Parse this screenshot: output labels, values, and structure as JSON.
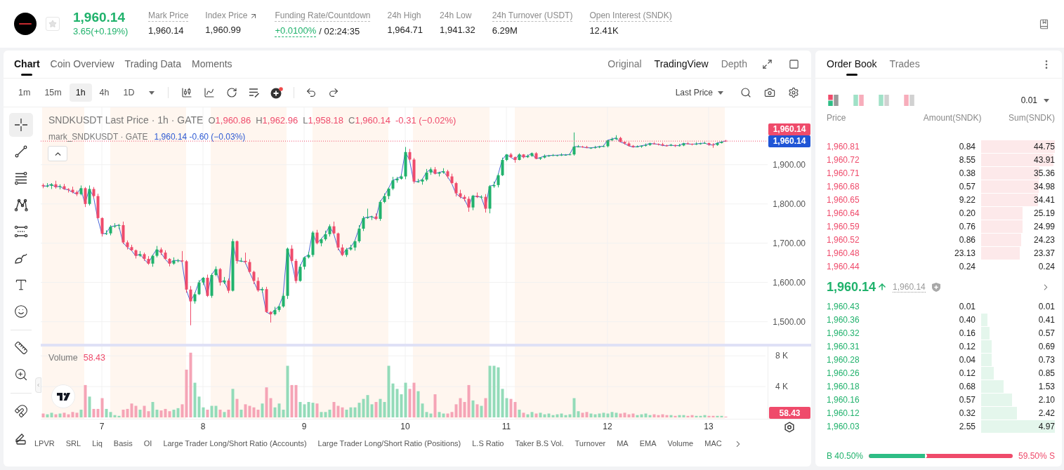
{
  "header": {
    "price": "1,960.14",
    "change": "3.65(+0.19%)",
    "rising": true,
    "favorite": false,
    "stats": [
      {
        "label": "Mark Price",
        "value": "1,960.14",
        "kind": "tooltip"
      },
      {
        "label": "Index Price",
        "value": "1,960.99",
        "kind": "link"
      },
      {
        "label": "Funding Rate/Countdown",
        "value": "+0.0100%",
        "countdown": "/ 02:24:35",
        "kind": "rate"
      },
      {
        "label": "24h High",
        "value": "1,964.71",
        "kind": "plain"
      },
      {
        "label": "24h Low",
        "value": "1,941.32",
        "kind": "plain"
      },
      {
        "label": "24h Turnover (USDT)",
        "value": "6.29M",
        "kind": "tooltip"
      },
      {
        "label": "Open Interest (SNDK)",
        "value": "12.41K",
        "kind": "tooltip"
      }
    ]
  },
  "chart_panel": {
    "tabs": [
      {
        "label": "Chart",
        "selected": true
      },
      {
        "label": "Coin Overview",
        "selected": false
      },
      {
        "label": "Trading Data",
        "selected": false
      },
      {
        "label": "Moments",
        "selected": false
      }
    ],
    "views": [
      {
        "label": "Original",
        "selected": false
      },
      {
        "label": "TradingView",
        "selected": true
      },
      {
        "label": "Depth",
        "selected": false
      }
    ],
    "intervals": [
      {
        "label": "1m",
        "selected": false
      },
      {
        "label": "15m",
        "selected": false
      },
      {
        "label": "1h",
        "selected": true
      },
      {
        "label": "4h",
        "selected": false
      },
      {
        "label": "1D",
        "selected": false
      }
    ],
    "price_source": "Last Price",
    "tool_groups": [
      {
        "tools": [
          {
            "kind": "crosshair",
            "selected": true
          },
          {
            "kind": "trend_line",
            "selected": false
          },
          {
            "kind": "fib",
            "selected": false
          },
          {
            "kind": "pattern",
            "selected": false
          },
          {
            "kind": "channel",
            "selected": false
          },
          {
            "kind": "brush",
            "selected": false
          },
          {
            "kind": "text",
            "selected": false
          },
          {
            "kind": "emoji",
            "selected": false
          }
        ]
      },
      {
        "tools": [
          {
            "kind": "measure",
            "selected": false
          },
          {
            "kind": "zoom",
            "selected": false
          }
        ]
      },
      {
        "tools": [
          {
            "kind": "magnet",
            "selected": false
          },
          {
            "kind": "lock",
            "selected": false
          }
        ]
      }
    ],
    "legend": {
      "title": "SNDKUSDT Last Price · 1h · GATE",
      "rising": false,
      "ohlc": [
        {
          "key": "O",
          "value": "1,960.86"
        },
        {
          "key": "H",
          "value": "1,962.96"
        },
        {
          "key": "L",
          "value": "1,958.18"
        },
        {
          "key": "C",
          "value": "1,960.14"
        }
      ],
      "change": "-0.31 (−0.02%)"
    },
    "mark_legend": {
      "title": "mark_SNDKUSDT · GATE",
      "value": "1,960.14 -0.60 (−0.03%)"
    },
    "price_chart": {
      "axis_labels": [
        "1,900.00",
        "1,800.00",
        "1,700.00",
        "1,600.00",
        "1,500.00"
      ],
      "last_label": "1,960.14",
      "mark_label": "1,960.14"
    },
    "volume_chart": {
      "value": "58.43",
      "axis_label": "58.43",
      "chart_data": {
        "type": "bar",
        "categories": [
          null,
          null,
          null,
          null,
          null,
          null,
          null,
          null,
          null,
          null,
          null,
          null,
          null,
          null,
          "7",
          null,
          null,
          null,
          null,
          null,
          null,
          null,
          null,
          null,
          null,
          null,
          null,
          null,
          null,
          null,
          null,
          null,
          null,
          null,
          null,
          null,
          null,
          null,
          "8",
          null,
          null,
          null,
          null,
          null,
          null,
          null,
          null,
          null,
          null,
          null,
          null,
          null,
          null,
          null,
          null,
          null,
          null,
          null,
          null,
          null,
          null,
          null,
          "9",
          null,
          null,
          null,
          null,
          null,
          null,
          null,
          null,
          null,
          null,
          null,
          null,
          null,
          null,
          null,
          null,
          null,
          null,
          null,
          null,
          null,
          null,
          null,
          "10",
          null,
          null,
          null,
          null,
          null,
          null,
          null,
          null,
          null,
          null,
          null,
          null,
          null,
          null,
          null,
          null,
          null,
          null,
          null,
          null,
          null,
          null,
          null,
          "11",
          null,
          null,
          null,
          null,
          null,
          null,
          null,
          null,
          null,
          null,
          null,
          null,
          null,
          null,
          null,
          null,
          null,
          null,
          null,
          null,
          null,
          null,
          null,
          "12",
          null,
          null,
          null,
          null,
          null,
          null,
          null,
          null,
          null,
          null,
          null,
          null,
          null,
          null,
          null,
          null,
          null,
          null,
          null,
          null,
          null,
          null,
          null,
          "13",
          null,
          null,
          null,
          null,
          null,
          null,
          null,
          null,
          null,
          null,
          null,
          null,
          null
        ],
        "ylim": [
          0,
          9.2
        ],
        "yticks": [
          {
            "value": 4,
            "label": "4 K"
          },
          {
            "value": 8,
            "label": "8 K"
          }
        ],
        "series": [
          {
            "name": "Volume",
            "values": [
              0.5,
              0.4,
              0.6,
              0.4,
              0.5,
              0.6,
              0.4,
              0.7,
              0.6,
              1.0,
              4.2,
              2.7,
              1.1,
              1.1,
              2.5,
              1.1,
              0.7,
              0.3,
              0.2,
              1.0,
              1.1,
              1.8,
              1.5,
              1.0,
              1.5,
              0.8,
              2.0,
              1.0,
              0.9,
              1.1,
              0.8,
              1.0,
              1.2,
              1.7,
              6.2,
              8.4,
              4.5,
              2.7,
              1.3,
              1.0,
              1.5,
              1.5,
              1.0,
              0.7,
              1.0,
              3.7,
              2.4,
              1.0,
              1.7,
              1.5,
              1.3,
              1.0,
              1.8,
              3.9,
              2.5,
              1.3,
              1.8,
              1.0,
              6.7,
              4.2,
              4.2,
              2.0,
              1.7,
              2.0,
              1.9,
              1.8,
              0.7,
              0.7,
              1.0,
              2.0,
              1.5,
              1.3,
              1.0,
              1.3,
              1.3,
              1.9,
              2.4,
              2.9,
              1.7,
              2.0,
              2.4,
              2.0,
              6.7,
              4.4,
              3.7,
              3.0,
              4.5,
              3.7,
              4.5,
              3.4,
              1.8,
              0.7,
              0.5,
              3.0,
              0.7,
              0.5,
              0.5,
              0.7,
              1.7,
              2.5,
              2.0,
              4.2,
              2.2,
              1.7,
              1.5,
              2.5,
              6.7,
              6.7,
              6.5,
              3.7,
              2.5,
              2.4,
              2.0,
              1.0,
              0.6,
              0.4,
              0.7,
              0.5,
              0.6,
              0.4,
              0.5,
              0.3,
              0.4,
              0.5,
              0.3,
              0.4,
              2.5,
              0.8,
              0.6,
              0.7,
              0.5,
              0.4,
              0.5,
              0.6,
              0.5,
              0.7,
              0.6,
              0.5,
              0.6,
              0.4,
              0.5,
              0.3,
              0.4,
              0.5,
              0.3,
              0.4,
              0.3,
              0.4,
              0.3,
              0.3,
              0.2,
              0.3,
              0.3,
              0.2,
              0.3,
              0.2,
              0.2,
              0.3,
              0.2,
              0.2,
              0.2,
              0.2,
              0.1,
              null,
              null,
              null,
              null,
              null,
              null,
              null,
              null,
              null
            ]
          }
        ]
      }
    },
    "indicators": [
      "LPVR",
      "SRL",
      "Liq",
      "Basis",
      "OI",
      "Large Trader Long/Short Ratio (Accounts)",
      "Large Trader Long/Short Ratio (Positions)",
      "L.S Ratio",
      "Taker B.S Vol.",
      "Turnover",
      "MA",
      "EMA",
      "Volume",
      "MAC"
    ]
  },
  "order_book": {
    "tabs": [
      {
        "label": "Order Book",
        "selected": true
      },
      {
        "label": "Trades",
        "selected": false
      }
    ],
    "layouts": [
      {
        "kind": "combined",
        "selected": true
      },
      {
        "kind": "side_by_side",
        "selected": false
      },
      {
        "kind": "bids",
        "selected": false
      },
      {
        "kind": "asks",
        "selected": false
      }
    ],
    "precision": "0.01",
    "columns": [
      "Price",
      "Amount(SNDK)",
      "Sum(SNDK)"
    ],
    "asks": [
      {
        "price": "1,960.81",
        "amount": "0.84",
        "sum": "44.75"
      },
      {
        "price": "1,960.72",
        "amount": "8.55",
        "sum": "43.91"
      },
      {
        "price": "1,960.71",
        "amount": "0.38",
        "sum": "35.36"
      },
      {
        "price": "1,960.68",
        "amount": "0.57",
        "sum": "34.98"
      },
      {
        "price": "1,960.65",
        "amount": "9.22",
        "sum": "34.41"
      },
      {
        "price": "1,960.64",
        "amount": "0.20",
        "sum": "25.19"
      },
      {
        "price": "1,960.59",
        "amount": "0.76",
        "sum": "24.99"
      },
      {
        "price": "1,960.52",
        "amount": "0.86",
        "sum": "24.23"
      },
      {
        "price": "1,960.48",
        "amount": "23.13",
        "sum": "23.37"
      },
      {
        "price": "1,960.44",
        "amount": "0.24",
        "sum": "0.24"
      }
    ],
    "last_price": "1,960.14",
    "last_rising": true,
    "mark_price": "1,960.14",
    "bids": [
      {
        "price": "1,960.43",
        "amount": "0.01",
        "sum": "0.01"
      },
      {
        "price": "1,960.36",
        "amount": "0.40",
        "sum": "0.41"
      },
      {
        "price": "1,960.32",
        "amount": "0.16",
        "sum": "0.57"
      },
      {
        "price": "1,960.31",
        "amount": "0.12",
        "sum": "0.69"
      },
      {
        "price": "1,960.28",
        "amount": "0.04",
        "sum": "0.73"
      },
      {
        "price": "1,960.26",
        "amount": "0.12",
        "sum": "0.85"
      },
      {
        "price": "1,960.18",
        "amount": "0.68",
        "sum": "1.53"
      },
      {
        "price": "1,960.16",
        "amount": "0.57",
        "sum": "2.10"
      },
      {
        "price": "1,960.12",
        "amount": "0.32",
        "sum": "2.42"
      },
      {
        "price": "1,960.03",
        "amount": "2.55",
        "sum": "4.97"
      }
    ],
    "ratio": {
      "buy": "B 40.50%",
      "sell": "59.50% S",
      "level": 0.405
    }
  }
}
